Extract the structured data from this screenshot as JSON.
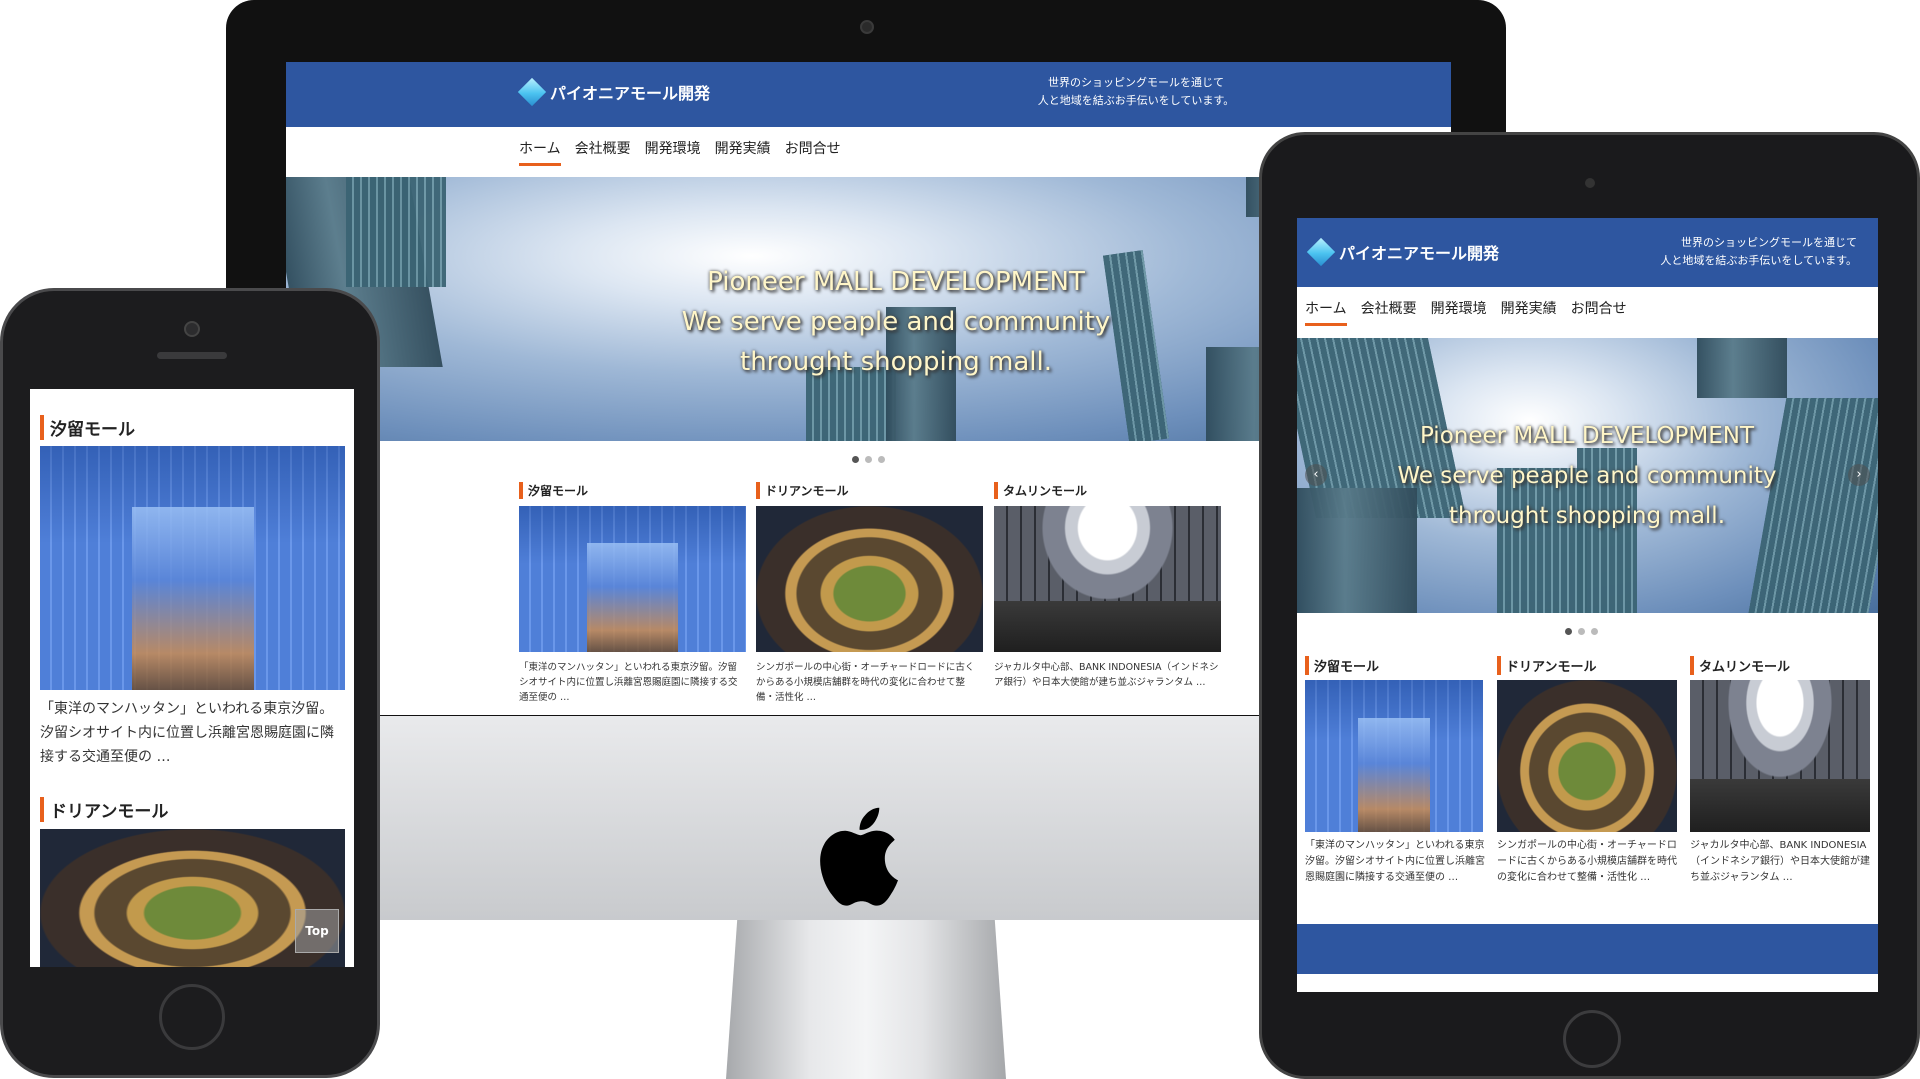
{
  "site": {
    "logo_text": "パイオニアモール開発",
    "tagline_line1": "世界のショッピングモールを通じて",
    "tagline_line2": "人と地域を結ぶお手伝いをしています。",
    "nav": [
      "ホーム",
      "会社概要",
      "開発環境",
      "開発実績",
      "お問合せ"
    ],
    "hero_line1": "Pioneer MALL DEVELOPMENT",
    "hero_line2": "We serve peaple and community",
    "hero_line3": "throught shopping mall.",
    "cards": [
      {
        "title": "汐留モール",
        "image": "shiodome-mall-photo",
        "desc": "「東洋のマンハッタン」といわれる東京汐留。汐留シオサイト内に位置し浜離宮恩賜庭園に隣接する交通至便の …"
      },
      {
        "title": "ドリアンモール",
        "image": "durian-mall-photo",
        "desc": "シンガポールの中心街・オーチャードロードに古くからある小規模店舗群を時代の変化に合わせて整備・活性化 …"
      },
      {
        "title": "タムリンモール",
        "image": "thamrin-mall-photo",
        "desc": "ジャカルタ中心部、BANK INDONESIA（インドネシア銀行）や日本大使館が建ち並ぶジャランタム …"
      }
    ],
    "top_button": "Top"
  },
  "colors": {
    "brand_blue": "#2e56a0",
    "accent_orange": "#e8601c"
  }
}
